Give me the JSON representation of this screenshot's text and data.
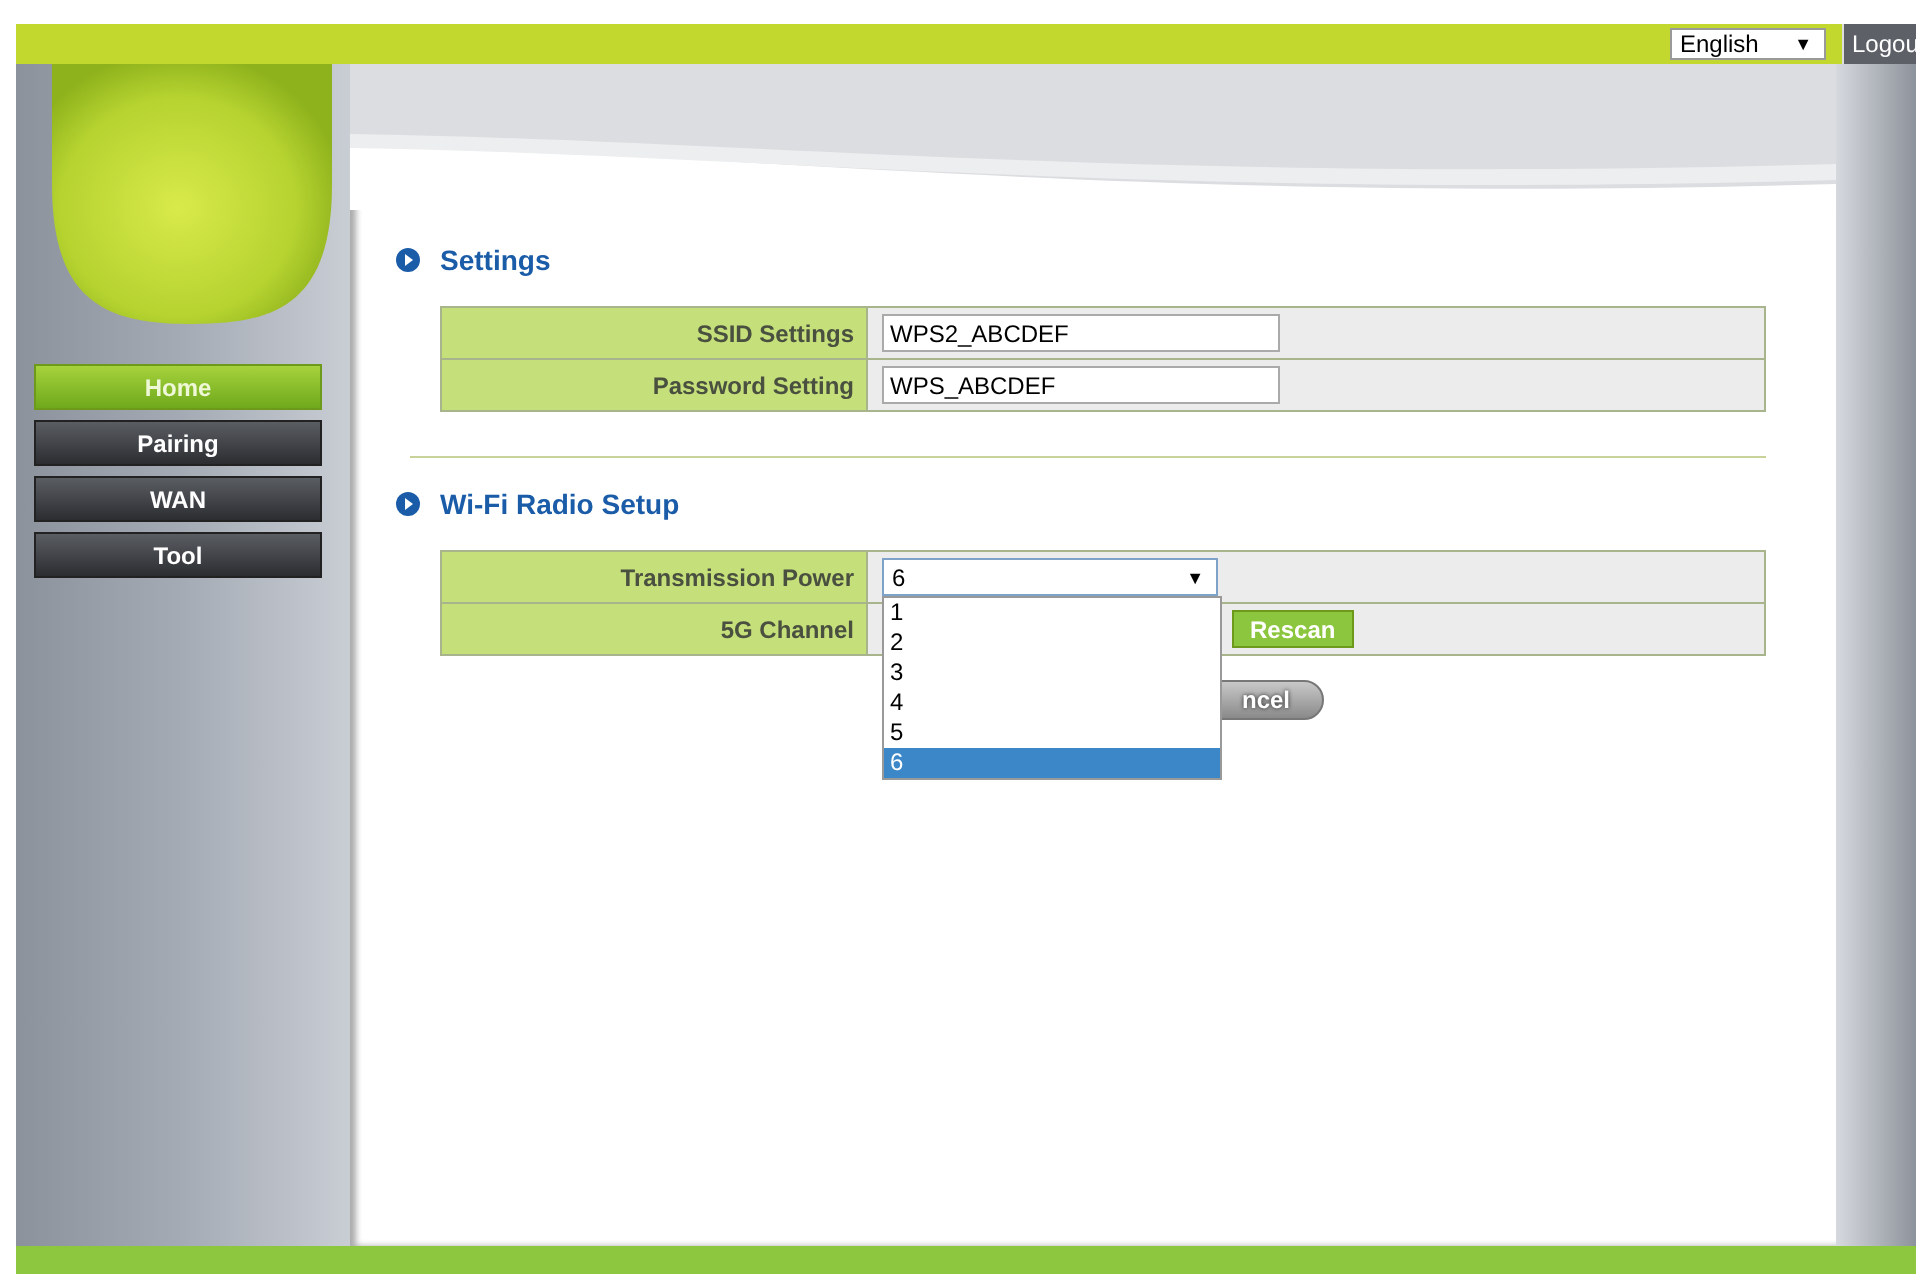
{
  "top_bar": {
    "language": {
      "value": "English",
      "arrow": "▼"
    },
    "logout": "Logou"
  },
  "sidebar": {
    "items": [
      {
        "label": "Home",
        "selected": true
      },
      {
        "label": "Pairing",
        "selected": false
      },
      {
        "label": "WAN",
        "selected": false
      },
      {
        "label": "Tool",
        "selected": false
      }
    ]
  },
  "sections": [
    {
      "title": "Settings",
      "rows": [
        {
          "kind": "text",
          "label": "SSID Settings",
          "value": "WPS2_ABCDEF"
        },
        {
          "kind": "text",
          "label": "Password Setting",
          "value": "WPS_ABCDEF"
        }
      ]
    },
    {
      "title": "Wi-Fi Radio Setup",
      "rows": [
        {
          "kind": "select",
          "label": "Transmission Power",
          "value": "6",
          "arrow": "▼",
          "expanded": true,
          "options": [
            {
              "label": "1",
              "selected": false
            },
            {
              "label": "2",
              "selected": false
            },
            {
              "label": "3",
              "selected": false
            },
            {
              "label": "4",
              "selected": false
            },
            {
              "label": "5",
              "selected": false
            },
            {
              "label": "6",
              "selected": true
            }
          ]
        },
        {
          "kind": "channel",
          "label": "5G Channel",
          "button": "Rescan"
        }
      ]
    }
  ],
  "cancel_button": "ncel"
}
